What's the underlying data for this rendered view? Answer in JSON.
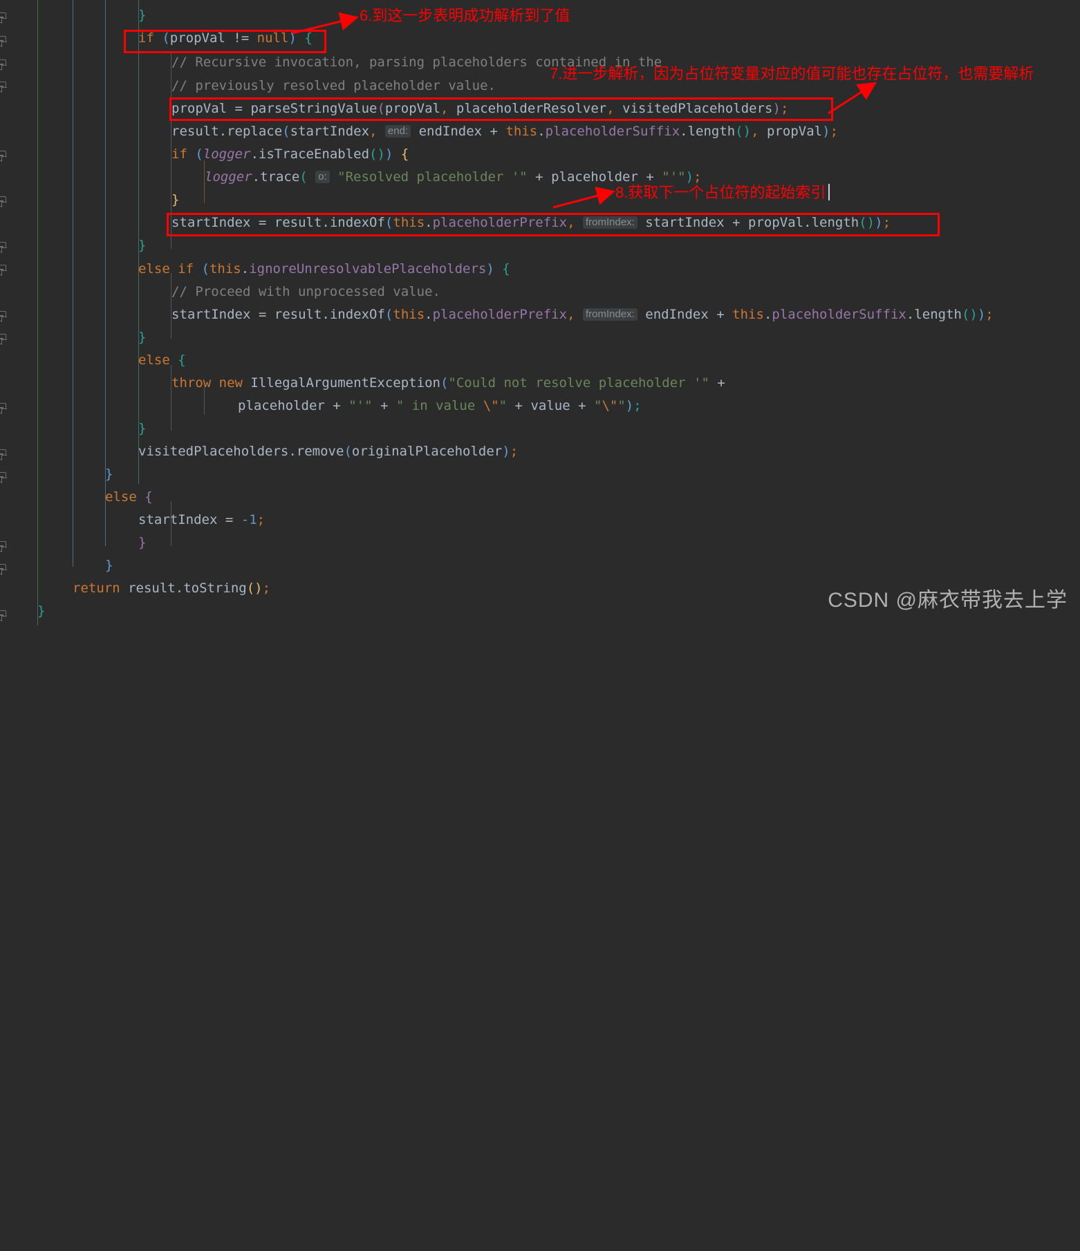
{
  "app": {
    "kind": "code-editor",
    "theme": "darcula",
    "background": "#2b2b2b",
    "foreground": "#a9b7c6",
    "annotation_color": "#ff0000"
  },
  "code": {
    "language": "java",
    "lines": [
      {
        "indent": 0,
        "text": "}"
      },
      {
        "indent": 0,
        "text": "if (propVal != null) {"
      },
      {
        "indent": 0,
        "text": "// Recursive invocation, parsing placeholders contained in the"
      },
      {
        "indent": 0,
        "text": "// previously resolved placeholder value."
      },
      {
        "indent": 0,
        "text": "propVal = parseStringValue(propVal, placeholderResolver, visitedPlaceholders);"
      },
      {
        "indent": 0,
        "text": "result.replace(startIndex, end: endIndex + this.placeholderSuffix.length(), propVal);"
      },
      {
        "indent": 0,
        "text": "if (logger.isTraceEnabled()) {"
      },
      {
        "indent": 0,
        "text": "logger.trace( o: \"Resolved placeholder '\" + placeholder + \"'\");"
      },
      {
        "indent": 0,
        "text": "}"
      },
      {
        "indent": 0,
        "text": "startIndex = result.indexOf(this.placeholderPrefix, fromIndex: startIndex + propVal.length());"
      },
      {
        "indent": 0,
        "text": "}"
      },
      {
        "indent": 0,
        "text": "else if (this.ignoreUnresolvablePlaceholders) {"
      },
      {
        "indent": 0,
        "text": "// Proceed with unprocessed value."
      },
      {
        "indent": 0,
        "text": "startIndex = result.indexOf(this.placeholderPrefix, fromIndex: endIndex + this.placeholderSuffix.length());"
      },
      {
        "indent": 0,
        "text": "}"
      },
      {
        "indent": 0,
        "text": "else {"
      },
      {
        "indent": 0,
        "text": "throw new IllegalArgumentException(\"Could not resolve placeholder '\" +"
      },
      {
        "indent": 0,
        "text": "placeholder + \"'\" + \" in value \\\"\" + value + \"\\\"\");"
      },
      {
        "indent": 0,
        "text": "}"
      },
      {
        "indent": 0,
        "text": "visitedPlaceholders.remove(originalPlaceholder);"
      },
      {
        "indent": 0,
        "text": "}"
      },
      {
        "indent": 0,
        "text": "else {"
      },
      {
        "indent": 0,
        "text": "startIndex = -1;"
      },
      {
        "indent": 0,
        "text": "}"
      },
      {
        "indent": 0,
        "text": "}"
      },
      {
        "indent": 0,
        "text": "return result.toString();"
      },
      {
        "indent": 0,
        "text": "}"
      }
    ],
    "parameter_hints": [
      "end:",
      "o:",
      "fromIndex:",
      "fromIndex:"
    ]
  },
  "annotations": [
    {
      "id": "ann-6",
      "label": "6.到这一步表明成功解析到了值"
    },
    {
      "id": "ann-7",
      "label": "7.进一步解析，因为占位符变量对应的值可能也存在占位符，也需要解析"
    },
    {
      "id": "ann-8",
      "label": "8.获取下一个占位符的起始索引"
    }
  ],
  "watermark": {
    "text": "CSDN @麻衣带我去上学"
  }
}
